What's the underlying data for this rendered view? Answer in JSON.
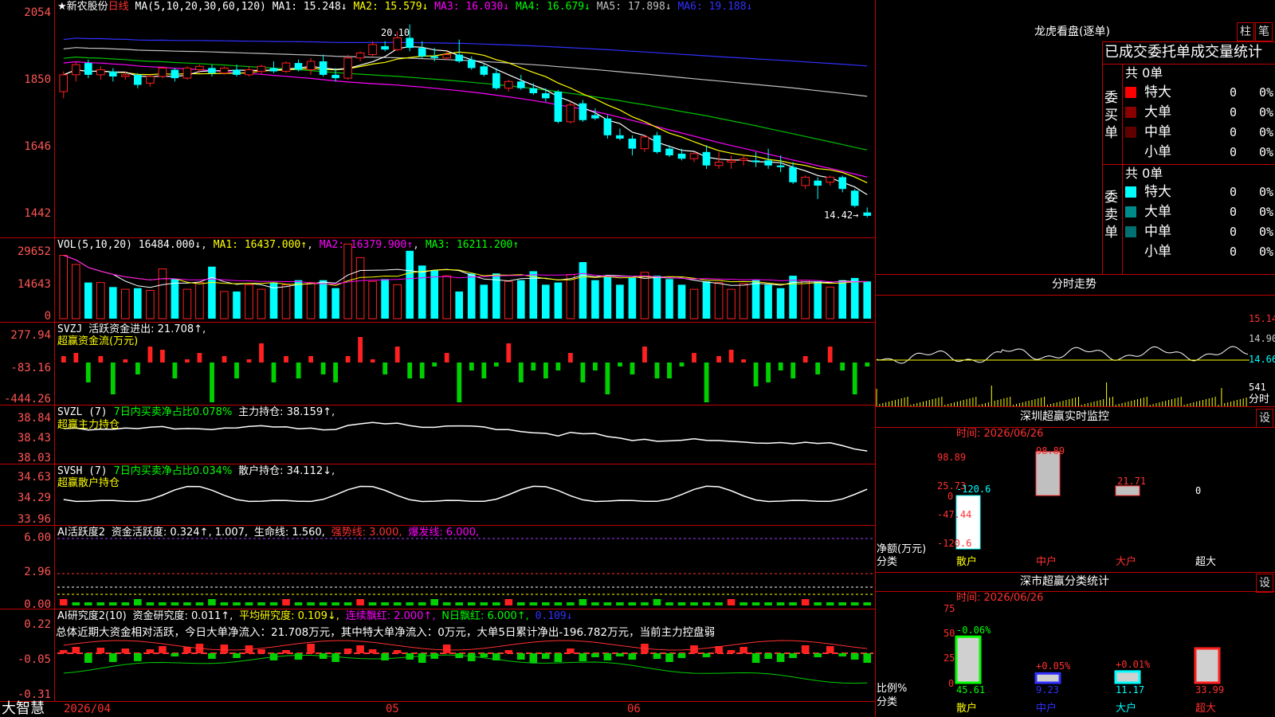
{
  "colors": {
    "up": "#ff2020",
    "down": "#00ffff",
    "ma1": "#ffffff",
    "ma2": "#ffff00",
    "ma3": "#ff00ff",
    "ma4": "#00c000",
    "ma5": "#c0c0c0",
    "ma6": "#3030ff",
    "grid": "#c00000"
  },
  "price_panel": {
    "star": "★",
    "stock_name": "新农股份",
    "period": "日线",
    "ma_params": "MA(5,10,20,30,60,120)",
    "ma1": "MA1: 15.248↓",
    "ma2": "MA2: 15.579↓",
    "ma3": "MA3: 16.030↓",
    "ma4": "MA4: 16.679↓",
    "ma5": "MA5: 17.898↓",
    "ma6": "MA6: 19.188↓",
    "high_mark": "20.10",
    "low_mark": "14.42→",
    "axis": [
      "2054",
      "1850",
      "1646",
      "1442"
    ]
  },
  "vol_panel": {
    "label": "VOL(5,10,20)",
    "value": "16484.000↓",
    "ma1": "MA1: 16437.000↑",
    "ma2": "MA2: 16379.900↑",
    "ma3": "MA3: 16211.200↑",
    "axis": [
      "29652",
      "14643",
      "0"
    ]
  },
  "svzj_panel": {
    "label": "SVZJ",
    "l1": "活跃资金进出: 21.708↑,",
    "l2": "超赢资金流(万元)",
    "axis": [
      "277.94",
      "-83.16",
      "-444.26"
    ]
  },
  "svzl_panel": {
    "label": "SVZL (7)",
    "l1": "7日内买卖净占比0.078%",
    "l2": "主力持仓: 38.159↑,",
    "l3": "超赢主力持仓",
    "axis": [
      "38.84",
      "38.43",
      "38.03"
    ]
  },
  "svsh_panel": {
    "label": "SVSH (7)",
    "l1": "7日内买卖净占比0.034%",
    "l2": "散户持仓: 34.112↓,",
    "l3": "超赢散户持仓",
    "axis": [
      "34.63",
      "34.29",
      "33.96"
    ]
  },
  "ai1_panel": {
    "label": "AI活跃度2",
    "l1": "资金活跃度: 0.324↑, 1.007,",
    "l2": "生命线: 1.560,",
    "l3": "强势线: 3.000,",
    "l4": "爆发线: 6.000,",
    "axis": [
      "6.00",
      "2.96",
      "0.00"
    ]
  },
  "ai2_panel": {
    "label": "AI研究度2(10)",
    "l1": "资金研究度: 0.011↑,",
    "l2": "平均研究度: 0.109↓,",
    "l3": "连续飘红: 2.000↑,",
    "l4": "N日飘红: 6.000↑,",
    "l5": "0.109↓",
    "summary": "总体近期大资金相对活跃，今日大单净流入：21.708万元，其中特大单净流入：0万元，大单5日累计净出-196.782万元，当前主力控盘弱",
    "axis": [
      "0.22",
      "-0.05",
      "-0.31"
    ]
  },
  "date_axis": {
    "d1": "2026/04",
    "d2": "05",
    "d3": "06"
  },
  "brand": "大智慧",
  "dragon": {
    "title": "龙虎看盘(逐单)",
    "btn1": "柱",
    "btn2": "笔",
    "subtitle": "已成交委托单成交量统计",
    "buy": {
      "label": "委买单",
      "total": "共 0单",
      "rows": [
        {
          "name": "特大",
          "v": "0",
          "p": "0%"
        },
        {
          "name": "大单",
          "v": "0",
          "p": "0%"
        },
        {
          "name": "中单",
          "v": "0",
          "p": "0%"
        },
        {
          "name": "小单",
          "v": "0",
          "p": "0%"
        }
      ]
    },
    "sell": {
      "label": "委卖单",
      "total": "共 0单",
      "rows": [
        {
          "name": "特大",
          "v": "0",
          "p": "0%"
        },
        {
          "name": "大单",
          "v": "0",
          "p": "0%"
        },
        {
          "name": "中单",
          "v": "0",
          "p": "0%"
        },
        {
          "name": "小单",
          "v": "0",
          "p": "0%"
        }
      ]
    }
  },
  "intraday": {
    "title": "分时走势",
    "p1": "15.14",
    "p2": "14.90",
    "p3": "14.66",
    "v1": "541",
    "v2": "分时"
  },
  "monitor": {
    "title": "深圳超赢实时监控",
    "btn": "设",
    "time": "时间: 2026/06/26",
    "axis": [
      "98.89",
      "25.73",
      "0",
      "-47.44",
      "-120.6"
    ],
    "ylabel": "净额(万元)",
    "xlabel": "分类",
    "bars": [
      {
        "cat": "散户",
        "value": -120.6,
        "label": "-120.6"
      },
      {
        "cat": "中户",
        "value": 98.89,
        "label": "98.89"
      },
      {
        "cat": "大户",
        "value": 21.71,
        "label": "21.71"
      },
      {
        "cat": "超大",
        "value": 0,
        "label": "0"
      }
    ]
  },
  "stats": {
    "title": "深市超赢分类统计",
    "btn": "设",
    "time": "时间: 2026/06/26",
    "axis": [
      "75",
      "50",
      "25",
      "0"
    ],
    "ylabel": "比例%",
    "xlabel": "分类",
    "bars": [
      {
        "cat": "散户",
        "value": 45.61,
        "top": "-0.06%",
        "bottom": "45.61"
      },
      {
        "cat": "中户",
        "value": 9.23,
        "top": "+0.05%",
        "bottom": "9.23"
      },
      {
        "cat": "大户",
        "value": 11.17,
        "top": "+0.01%",
        "bottom": "11.17"
      },
      {
        "cat": "超大",
        "value": 33.99,
        "top": "",
        "bottom": "33.99"
      }
    ]
  },
  "chart_data": {
    "type": "candlestick",
    "price_ylim": [
      1410,
      2060
    ],
    "candles": [
      [
        1830,
        1890,
        1880,
        1810
      ],
      [
        1880,
        1920,
        1910,
        1860
      ],
      [
        1915,
        1925,
        1880,
        1870
      ],
      [
        1880,
        1905,
        1895,
        1865
      ],
      [
        1890,
        1900,
        1875,
        1860
      ],
      [
        1875,
        1890,
        1880,
        1865
      ],
      [
        1880,
        1885,
        1850,
        1840
      ],
      [
        1855,
        1880,
        1875,
        1845
      ],
      [
        1875,
        1905,
        1900,
        1870
      ],
      [
        1895,
        1900,
        1870,
        1860
      ],
      [
        1870,
        1905,
        1900,
        1865
      ],
      [
        1895,
        1910,
        1905,
        1885
      ],
      [
        1900,
        1910,
        1885,
        1875
      ],
      [
        1885,
        1905,
        1900,
        1880
      ],
      [
        1895,
        1910,
        1880,
        1875
      ],
      [
        1880,
        1905,
        1895,
        1875
      ],
      [
        1890,
        1910,
        1905,
        1880
      ],
      [
        1900,
        1920,
        1890,
        1885
      ],
      [
        1890,
        1920,
        1915,
        1885
      ],
      [
        1915,
        1925,
        1895,
        1890
      ],
      [
        1895,
        1930,
        1920,
        1880
      ],
      [
        1920,
        1940,
        1880,
        1875
      ],
      [
        1880,
        1900,
        1870,
        1860
      ],
      [
        1870,
        1940,
        1930,
        1865
      ],
      [
        1930,
        1950,
        1945,
        1920
      ],
      [
        1940,
        1980,
        1970,
        1935
      ],
      [
        1965,
        1980,
        1955,
        1950
      ],
      [
        1955,
        2010,
        1990,
        1950
      ],
      [
        1990,
        2030,
        1960,
        1950
      ],
      [
        1960,
        1980,
        1935,
        1930
      ],
      [
        1935,
        1960,
        1930,
        1920
      ],
      [
        1930,
        1950,
        1940,
        1925
      ],
      [
        1940,
        1985,
        1920,
        1915
      ],
      [
        1925,
        1935,
        1900,
        1895
      ],
      [
        1905,
        1915,
        1880,
        1875
      ],
      [
        1885,
        1900,
        1840,
        1835
      ],
      [
        1840,
        1865,
        1860,
        1830
      ],
      [
        1860,
        1880,
        1840,
        1835
      ],
      [
        1840,
        1855,
        1825,
        1820
      ],
      [
        1825,
        1840,
        1810,
        1800
      ],
      [
        1830,
        1835,
        1740,
        1735
      ],
      [
        1740,
        1800,
        1790,
        1735
      ],
      [
        1795,
        1805,
        1745,
        1740
      ],
      [
        1760,
        1780,
        1750,
        1745
      ],
      [
        1750,
        1760,
        1700,
        1690
      ],
      [
        1700,
        1720,
        1690,
        1685
      ],
      [
        1690,
        1700,
        1660,
        1640
      ],
      [
        1660,
        1700,
        1695,
        1650
      ],
      [
        1700,
        1710,
        1650,
        1645
      ],
      [
        1660,
        1670,
        1640,
        1635
      ],
      [
        1645,
        1660,
        1630,
        1625
      ],
      [
        1630,
        1650,
        1645,
        1620
      ],
      [
        1650,
        1670,
        1610,
        1600
      ],
      [
        1610,
        1650,
        1620,
        1600
      ],
      [
        1620,
        1640,
        1625,
        1600
      ],
      [
        1625,
        1640,
        1630,
        1610
      ],
      [
        1625,
        1650,
        1620,
        1605
      ],
      [
        1625,
        1660,
        1610,
        1600
      ],
      [
        1610,
        1640,
        1605,
        1590
      ],
      [
        1605,
        1620,
        1560,
        1555
      ],
      [
        1550,
        1580,
        1575,
        1540
      ],
      [
        1565,
        1575,
        1550,
        1510
      ],
      [
        1560,
        1580,
        1575,
        1550
      ],
      [
        1575,
        1580,
        1540,
        1530
      ],
      [
        1535,
        1540,
        1490,
        1485
      ],
      [
        1470,
        1485,
        1460,
        1455
      ]
    ],
    "vol_ylim": [
      0,
      31000
    ],
    "volumes": [
      28000,
      24000,
      16000,
      16000,
      14000,
      13000,
      13500,
      12500,
      22000,
      17500,
      13000,
      16000,
      23000,
      12000,
      12000,
      15000,
      13000,
      16000,
      15000,
      17000,
      16000,
      17000,
      13500,
      33000,
      27000,
      16500,
      17500,
      15000,
      30000,
      23500,
      21500,
      19000,
      12000,
      20000,
      15000,
      20000,
      16500,
      17000,
      21000,
      15000,
      16000,
      19500,
      25000,
      17000,
      18500,
      15000,
      18000,
      20500,
      19000,
      17500,
      15000,
      13000,
      16500,
      16000,
      13000,
      15500,
      17000,
      15000,
      13500,
      19000,
      17000,
      16500,
      14000,
      17000,
      18000,
      16500
    ],
    "xlabels": [
      "2026/04",
      "05",
      "06"
    ]
  }
}
